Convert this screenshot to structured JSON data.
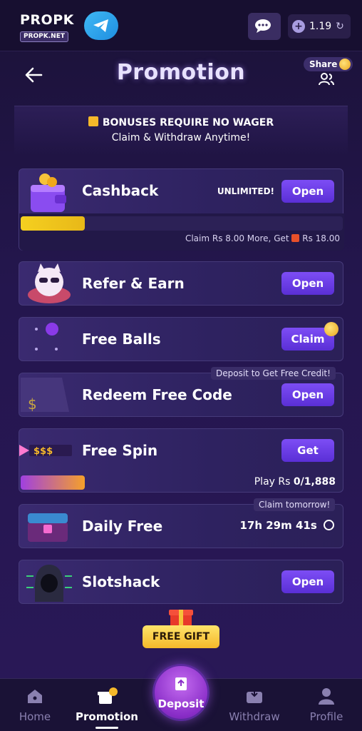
{
  "topbar": {
    "logo_main": "PROPK",
    "logo_sub": "PROPK.NET",
    "balance": "1.19",
    "icons": [
      "telegram-icon",
      "chat-icon",
      "add-funds-icon",
      "refresh-icon"
    ]
  },
  "header": {
    "title": "Promotion",
    "share_label": "Share"
  },
  "notice": {
    "line1": "BONUSES REQUIRE NO WAGER",
    "line2": "Claim & Withdraw Anytime!"
  },
  "cards": {
    "cashback": {
      "name": "Cashback",
      "badge": "UNLIMITED!",
      "button": "Open",
      "progress": 0.2,
      "note_prefix": "Claim Rs 8.00 More, Get",
      "note_suffix": "Rs 18.00"
    },
    "refer": {
      "name": "Refer & Earn",
      "button": "Open"
    },
    "balls": {
      "name": "Free Balls",
      "button": "Claim"
    },
    "redeem": {
      "name": "Redeem Free Code",
      "button": "Open",
      "tip": "Deposit to Get Free Credit!",
      "art_text": "$"
    },
    "spin": {
      "name": "Free Spin",
      "button": "Get",
      "art_text": "$$$",
      "progress_label": "Play Rs",
      "progress_value": "0/1,888",
      "progress": 0.2
    },
    "daily": {
      "name": "Daily Free",
      "tip": "Claim tomorrow!",
      "countdown": "17h 29m 41s"
    },
    "slotshack": {
      "name": "Slotshack",
      "button": "Open"
    }
  },
  "gift": {
    "label": "FREE GIFT"
  },
  "nav": {
    "home": "Home",
    "promotion": "Promotion",
    "deposit": "Deposit",
    "withdraw": "Withdraw",
    "profile": "Profile"
  },
  "colors": {
    "accent_button": "#6a3de8",
    "gold": "#f5b82a",
    "background": "#24164e"
  }
}
